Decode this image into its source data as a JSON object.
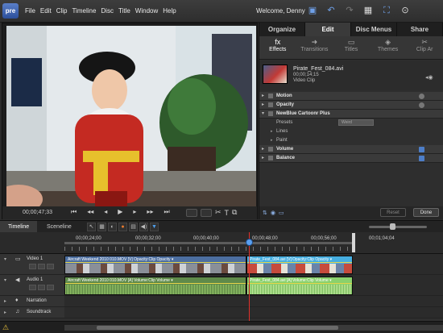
{
  "app": {
    "logo": "pre"
  },
  "menu": [
    "File",
    "Edit",
    "Clip",
    "Timeline",
    "Disc",
    "Title",
    "Window",
    "Help"
  ],
  "user": {
    "welcome": "Welcome, Denny"
  },
  "toolbar_icons": [
    "save-icon",
    "undo-icon",
    "redo-icon",
    "grid-icon",
    "fullscreen-icon",
    "help-icon"
  ],
  "monitor": {
    "timecode": "00;00;47;33",
    "transport": [
      "⏮",
      "◂◂",
      "◂",
      "▶",
      "▸",
      "▸▸",
      "⏭"
    ],
    "tools": [
      "✂",
      "T",
      "⧉"
    ]
  },
  "panel": {
    "tabs": [
      "Organize",
      "Edit",
      "Disc Menus",
      "Share"
    ],
    "active_tab": "Edit",
    "subtabs": [
      {
        "icon": "fx",
        "label": "Effects"
      },
      {
        "icon": "➜",
        "label": "Transitions"
      },
      {
        "icon": "▭",
        "label": "Titles"
      },
      {
        "icon": "◈",
        "label": "Themes"
      },
      {
        "icon": "✂",
        "label": "Clip Ar"
      }
    ],
    "active_subtab": "Effects",
    "clip": {
      "name": "Pirate_Fest_084.avi",
      "duration": "00;00;14;15",
      "type": "Video Clip"
    },
    "effects": [
      {
        "label": "Motion"
      },
      {
        "label": "Opacity"
      },
      {
        "label": "NewBlue Cartoonr Plus",
        "expanded": true,
        "params": [
          {
            "label": "Presets",
            "value": "Weird"
          },
          {
            "label": "Lines"
          },
          {
            "label": "Paint"
          }
        ]
      },
      {
        "label": "Volume"
      },
      {
        "label": "Balance"
      }
    ],
    "reset_label": "Reset",
    "done_label": "Done"
  },
  "timeline": {
    "tabs": [
      "Timeline",
      "Sceneline"
    ],
    "active_tab": "Timeline",
    "ruler": [
      "00;00;24;00",
      "00;00;32;00",
      "00;00;40;00",
      "00;00;48;00",
      "00;00;56;00",
      "00;01;04;04"
    ],
    "tracks": [
      {
        "name": "Video 1",
        "kind": "video"
      },
      {
        "name": "Audio 1",
        "kind": "audio"
      },
      {
        "name": "Narration",
        "kind": "narration"
      },
      {
        "name": "Soundtrack",
        "kind": "soundtrack"
      }
    ],
    "clips": {
      "video_a": "Aircraft Weekend 2010 010.MOV [V]  Opacity:Clip Opacity ▾",
      "video_b": "Pirate_Fest_084.avi [V]",
      "video_b_prop": "Opacity:Clip Opacity ▾",
      "audio_a": "Aircraft Weekend 2010 010.MOV [A]  Volume:Clip Volume ▾",
      "audio_b": "Pirate_Fest_084.avi [A]",
      "audio_b_prop": "Volume:Clip Volume ▾"
    }
  },
  "colors": {
    "accent": "#5a7fc9",
    "playhead": "#e0302b",
    "video_clip": "#4c6ea0",
    "audio_clip": "#5f8a4a"
  }
}
